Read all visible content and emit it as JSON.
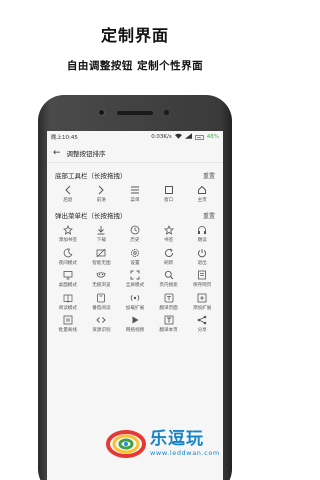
{
  "promo": {
    "title": "定制界面",
    "subtitle": "自由调整按钮  定制个性界面"
  },
  "status_bar": {
    "time": "晚上10:45",
    "speed": "0.03K/s",
    "battery": "48%"
  },
  "header": {
    "title": "调整按钮排序"
  },
  "toolbar_section": {
    "title": "底部工具栏（长按拖拽）",
    "reset_label": "重置",
    "items": [
      {
        "label": "后退",
        "icon": "chevron-left-icon"
      },
      {
        "label": "前进",
        "icon": "chevron-right-icon"
      },
      {
        "label": "菜单",
        "icon": "menu-icon"
      },
      {
        "label": "窗口",
        "icon": "window-icon"
      },
      {
        "label": "主页",
        "icon": "home-icon"
      }
    ]
  },
  "menu_section": {
    "title": "弹出菜单栏（长按拖拽）",
    "reset_label": "重置",
    "items": [
      {
        "label": "添加书签",
        "icon": "star-outline-icon"
      },
      {
        "label": "下载",
        "icon": "download-icon"
      },
      {
        "label": "历史",
        "icon": "clock-icon"
      },
      {
        "label": "书签",
        "icon": "star-icon"
      },
      {
        "label": "朗读",
        "icon": "headphones-icon"
      },
      {
        "label": "夜间模式",
        "icon": "moon-icon"
      },
      {
        "label": "智能无图",
        "icon": "no-image-icon"
      },
      {
        "label": "设置",
        "icon": "gear-icon"
      },
      {
        "label": "刷新",
        "icon": "refresh-icon"
      },
      {
        "label": "退出",
        "icon": "power-icon"
      },
      {
        "label": "桌面模式",
        "icon": "desktop-icon"
      },
      {
        "label": "无痕浏览",
        "icon": "mask-icon"
      },
      {
        "label": "全屏模式",
        "icon": "fullscreen-icon"
      },
      {
        "label": "页内搜索",
        "icon": "search-icon"
      },
      {
        "label": "保存网页",
        "icon": "save-page-icon"
      },
      {
        "label": "阅读模式",
        "icon": "book-icon"
      },
      {
        "label": "番茄阅读",
        "icon": "tomato-book-icon"
      },
      {
        "label": "加载扩展",
        "icon": "broadcast-icon"
      },
      {
        "label": "翻译页面",
        "icon": "translate-icon"
      },
      {
        "label": "添加扩展",
        "icon": "add-box-icon"
      },
      {
        "label": "批量离线",
        "icon": "pause-icon"
      },
      {
        "label": "资源识别",
        "icon": "code-icon"
      },
      {
        "label": "网络视频",
        "icon": "play-icon"
      },
      {
        "label": "翻译本页",
        "icon": "text-icon"
      },
      {
        "label": "分享",
        "icon": "share-icon"
      }
    ]
  },
  "watermark": {
    "brand": "乐逗玩",
    "url": "www.leddwan.com"
  },
  "colors": {
    "accent": "#1784c7",
    "battery": "#4caf50",
    "phone_body": "#333333"
  }
}
